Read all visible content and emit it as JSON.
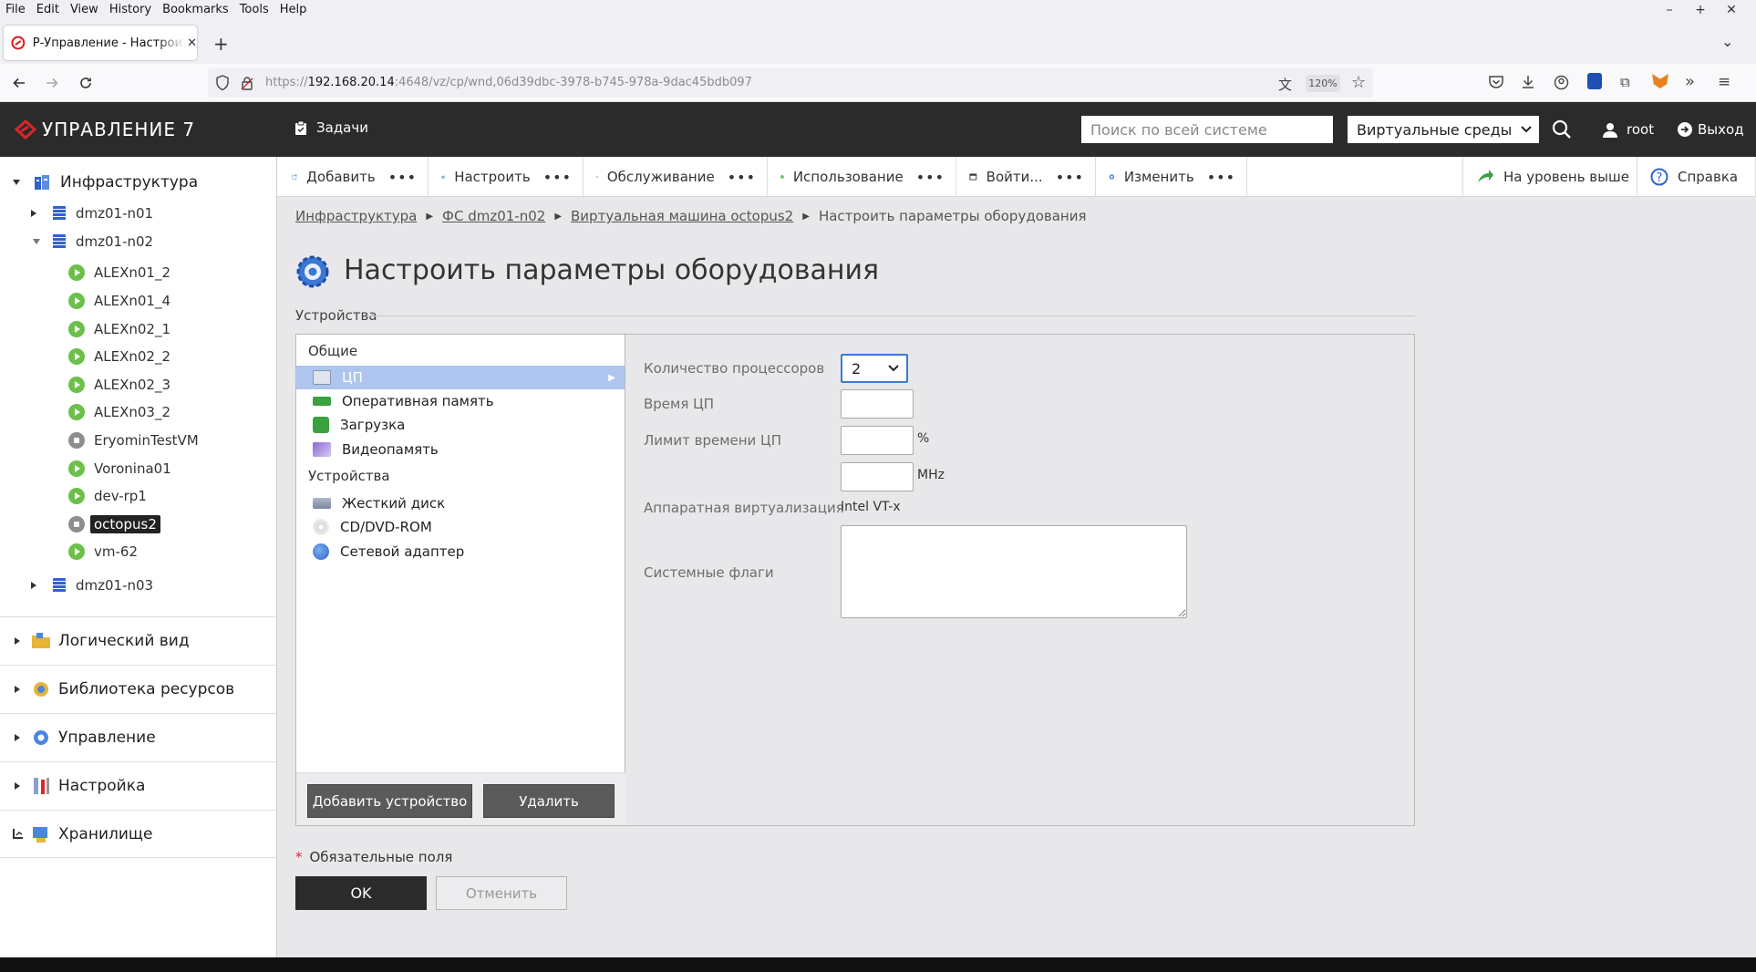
{
  "browser": {
    "menu": [
      "File",
      "Edit",
      "View",
      "History",
      "Bookmarks",
      "Tools",
      "Help"
    ],
    "tab_title": "Р-Управление - Настроить параметры оборудования",
    "url_prefix": "https://",
    "url_host": "192.168.20.14",
    "url_rest": ":4648/vz/cp/wnd,06d39dbc-3978-b745-978a-9dac45bdb097",
    "zoom": "120%"
  },
  "header": {
    "logo": "УПРАВЛЕНИЕ 7",
    "tasks": "Задачи",
    "search_placeholder": "Поиск по всей системе",
    "env_select": "Виртуальные среды",
    "user": "root",
    "logout": "Выход"
  },
  "sidebar": {
    "root": "Инфраструктура",
    "hosts": [
      "dmz01-n01",
      "dmz01-n02",
      "dmz01-n03"
    ],
    "vms": [
      {
        "name": "ALEXn01_2",
        "state": "running"
      },
      {
        "name": "ALEXn01_4",
        "state": "running"
      },
      {
        "name": "ALEXn02_1",
        "state": "running"
      },
      {
        "name": "ALEXn02_2",
        "state": "running"
      },
      {
        "name": "ALEXn02_3",
        "state": "running"
      },
      {
        "name": "ALEXn03_2",
        "state": "running"
      },
      {
        "name": "EryominTestVM",
        "state": "stopped"
      },
      {
        "name": "Voronina01",
        "state": "running"
      },
      {
        "name": "dev-rp1",
        "state": "running"
      },
      {
        "name": "octopus2",
        "state": "stopped"
      },
      {
        "name": "vm-62",
        "state": "running"
      }
    ],
    "sections": [
      "Логический вид",
      "Библиотека ресурсов",
      "Управление",
      "Настройка",
      "Хранилище"
    ]
  },
  "toolbar": {
    "add": "Добавить",
    "configure": "Настроить",
    "service": "Обслуживание",
    "usage": "Использование",
    "login": "Войти...",
    "change": "Изменить",
    "up": "На уровень выше",
    "help": "Справка",
    "more": "•••"
  },
  "breadcrumb": [
    "Инфраструктура",
    "ФС dmz01-n02",
    "Виртуальная машина octopus2",
    "Настроить параметры оборудования"
  ],
  "page": {
    "title": "Настроить параметры оборудования",
    "devices_section": "Устройства"
  },
  "device_list": {
    "group_general": "Общие",
    "general": [
      "ЦП",
      "Оперативная память",
      "Загрузка",
      "Видеопамять"
    ],
    "group_devices": "Устройства",
    "devices": [
      "Жесткий диск",
      "CD/DVD-ROM",
      "Сетевой адаптер"
    ],
    "add_button": "Добавить устройство",
    "delete_button": "Удалить"
  },
  "cpu_form": {
    "cpu_count_label": "Количество процессоров",
    "cpu_count_value": "2",
    "cpu_time_label": "Время ЦП",
    "cpu_limit_label": "Лимит времени ЦП",
    "unit_percent": "%",
    "unit_mhz": "MHz",
    "hw_virt_label": "Аппаратная виртуализация",
    "hw_virt_value": "Intel VT-x",
    "sys_flags_label": "Системные флаги"
  },
  "footer": {
    "required": "Обязательные поля",
    "ok": "OK",
    "cancel": "Отменить"
  },
  "colors": {
    "accent_red": "#d9262c",
    "header_bg": "#2b2b2b",
    "selection": "#aec6ef",
    "vm_running": "#6cc04a",
    "vm_stopped": "#8e8e8e"
  }
}
